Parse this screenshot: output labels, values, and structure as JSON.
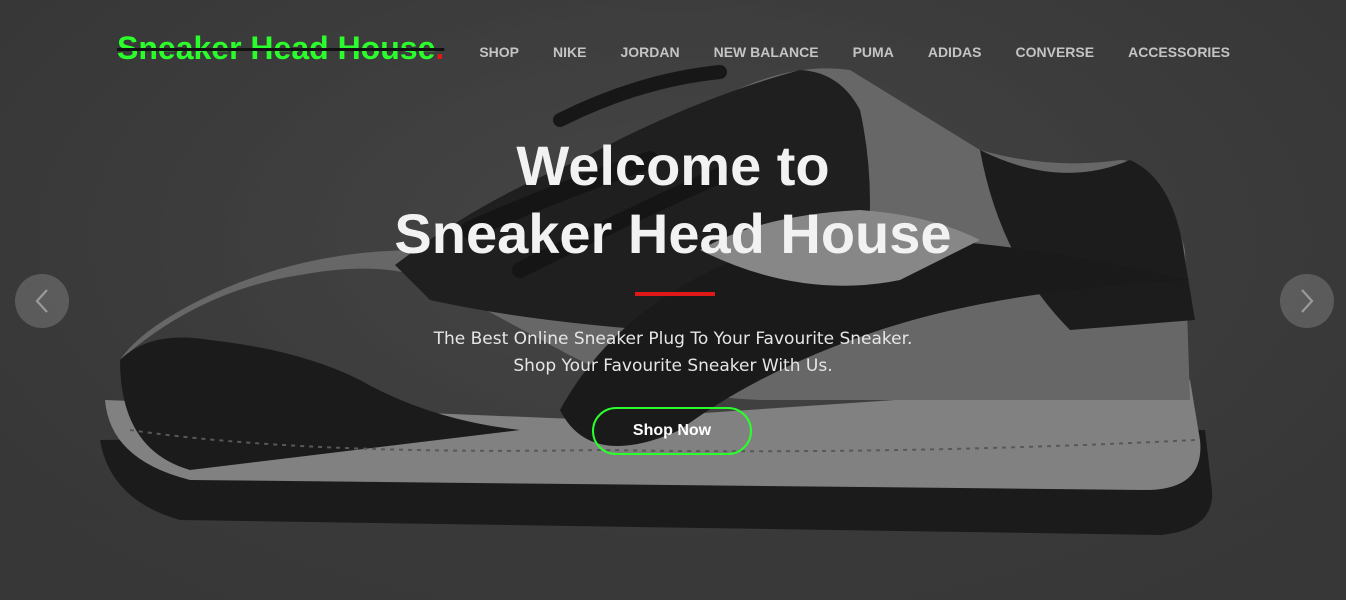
{
  "brand": {
    "name": "Sneaker Head House",
    "dot": ".",
    "accent_color": "#2bff2b",
    "dot_color": "#e01818"
  },
  "nav": {
    "items": [
      {
        "label": "SHOP"
      },
      {
        "label": "NIKE"
      },
      {
        "label": "JORDAN"
      },
      {
        "label": "NEW BALANCE"
      },
      {
        "label": "PUMA"
      },
      {
        "label": "ADIDAS"
      },
      {
        "label": "CONVERSE"
      },
      {
        "label": "ACCESSORIES"
      }
    ]
  },
  "hero": {
    "headline_line1": "Welcome to",
    "headline_line2": "Sneaker Head House",
    "sub_line1": "The Best Online Sneaker Plug To Your Favourite Sneaker.",
    "sub_line2": "Shop Your Favourite Sneaker With Us.",
    "cta_label": "Shop Now",
    "cta_border_color": "#2bff2b",
    "divider_color": "#e01818"
  },
  "carousel": {
    "prev_icon": "chevron-left-icon",
    "next_icon": "chevron-right-icon"
  }
}
